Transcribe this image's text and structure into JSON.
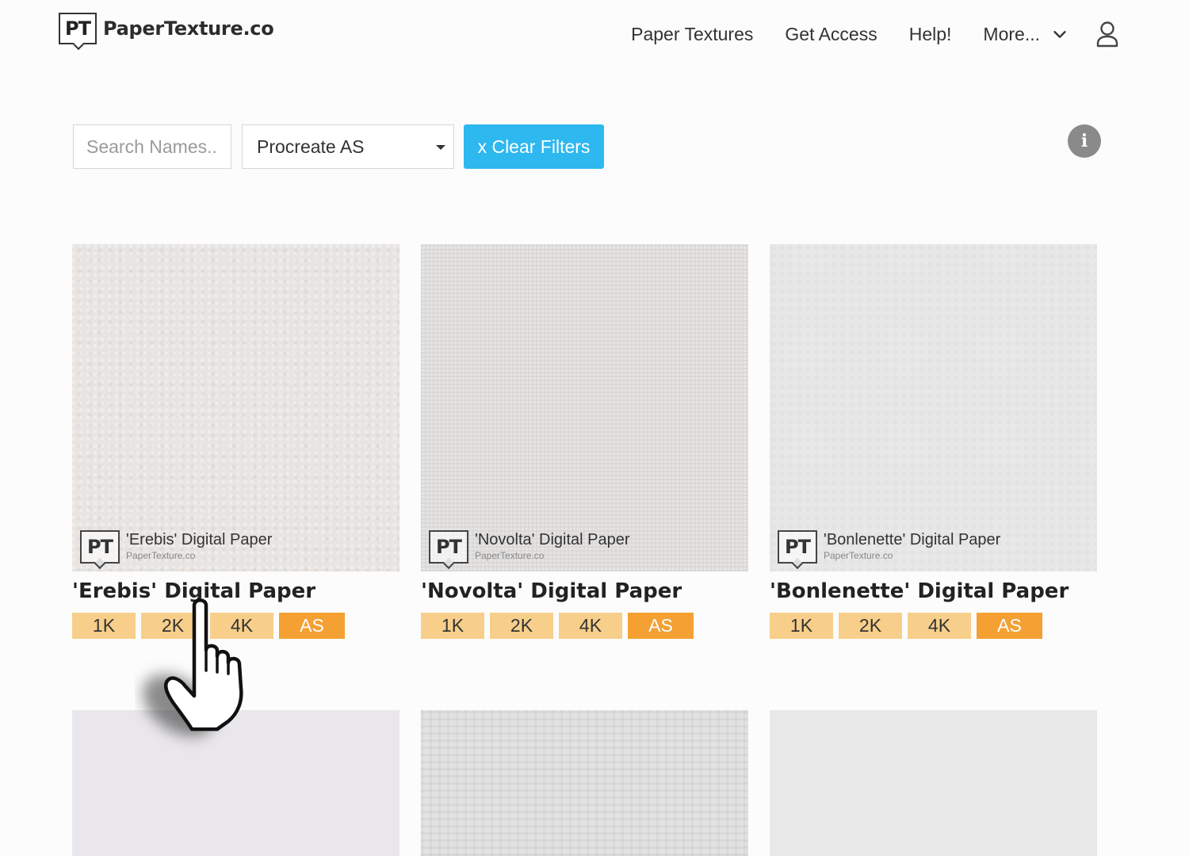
{
  "header": {
    "logo_mark": "PT",
    "logo_text": "PaperTexture.co",
    "nav": [
      "Paper Textures",
      "Get Access",
      "Help!",
      "More..."
    ]
  },
  "filters": {
    "search_placeholder": "Search Names...",
    "select_value": "Procreate AS",
    "clear_label": "x Clear Filters",
    "info_glyph": "i"
  },
  "watermark": {
    "mark": "PT",
    "site": "PaperTexture.co"
  },
  "cards": [
    {
      "title": "'Erebis' Digital Paper",
      "badges": [
        "1K",
        "2K",
        "4K",
        "AS"
      ]
    },
    {
      "title": "'Novolta' Digital Paper",
      "badges": [
        "1K",
        "2K",
        "4K",
        "AS"
      ]
    },
    {
      "title": "'Bonlenette' Digital Paper",
      "badges": [
        "1K",
        "2K",
        "4K",
        "AS"
      ]
    }
  ],
  "colors": {
    "accent_button": "#2eb8f0",
    "badge": "#f7cf8a",
    "badge_active": "#f4a032"
  },
  "icons": {
    "user": "user-icon",
    "dropdown": "chevron-down-icon",
    "info": "info-icon",
    "cursor": "hand-pointer-icon"
  }
}
